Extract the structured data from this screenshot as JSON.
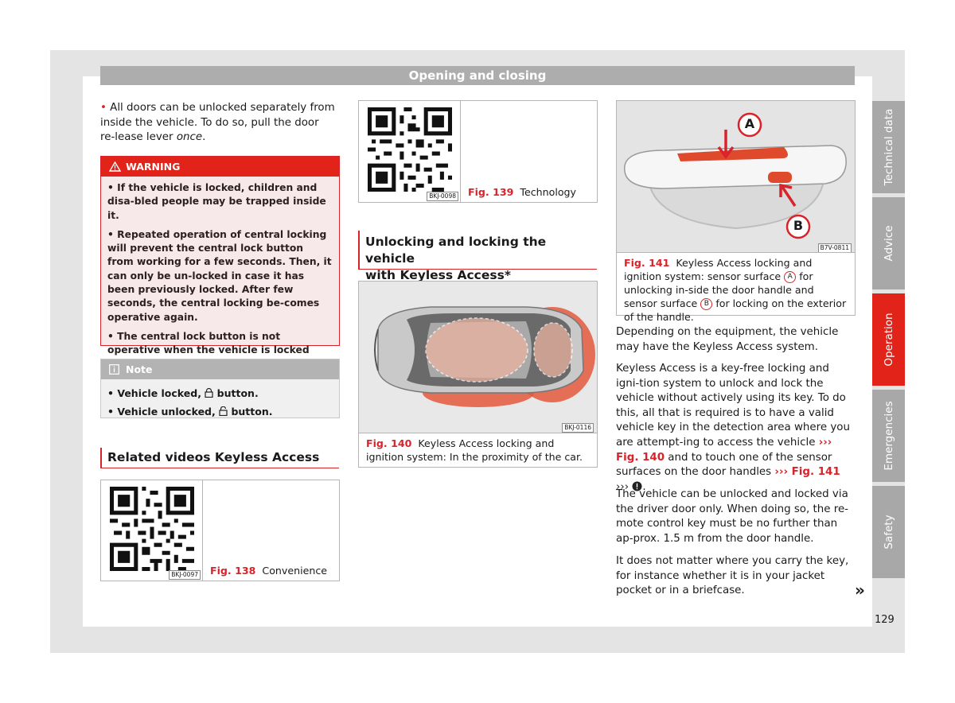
{
  "header": {
    "title": "Opening and closing"
  },
  "col1": {
    "intro_bullet": "•",
    "intro_text_main": " All doors can be unlocked separately from inside the vehicle. To do so, pull the door re-lease lever ",
    "intro_text_em": "once",
    "intro_text_end": ".",
    "warning": {
      "title": "WARNING",
      "items": [
        "• If the vehicle is locked, children and disa-bled people may be trapped inside it.",
        "• Repeated operation of central locking will prevent the central lock button from working for a few seconds. Then, it can only be un-locked in case it has been previously locked. After few seconds, the central locking be-comes operative again.",
        "• The central lock button is not operative when the vehicle is locked from the outside (with the remote control or the key)."
      ]
    },
    "note": {
      "title": "Note",
      "items": [
        {
          "prefix": "• Vehicle locked,",
          "suffix": " button."
        },
        {
          "prefix": "• Vehicle unlocked,",
          "suffix": " button."
        }
      ]
    },
    "related_title": "Related videos Keyless Access",
    "fig138": {
      "code": "BKJ-0097",
      "label": "Fig. 138",
      "caption": "Convenience"
    }
  },
  "col2": {
    "fig139": {
      "code": "BKJ-0098",
      "label": "Fig. 139",
      "caption": "Technology"
    },
    "section_title_line1": "Unlocking and locking the vehicle",
    "section_title_line2": "with Keyless Access*",
    "fig140": {
      "code": "BKJ-0116",
      "label": "Fig. 140",
      "caption": "Keyless Access locking and ignition system: In the proximity of the car."
    }
  },
  "col3": {
    "fig141": {
      "code": "B7V-0811",
      "marker_a": "A",
      "marker_b": "B",
      "label": "Fig. 141",
      "caption_1": "Keyless Access locking and ignition system: sensor surface",
      "caption_2": "for unlocking in-side the door handle and sensor surface",
      "caption_3": "for locking on the exterior of the handle."
    },
    "para1": "Depending on the equipment, the vehicle may have the Keyless Access system.",
    "para2_a": "Keyless Access is a key-free locking and igni-tion system to unlock and lock the vehicle without actively using its key. To do this, all that is required is to have a valid vehicle key in the detection area where you are attempt-ing to access the vehicle ",
    "para2_ref1": "››› Fig. 140",
    "para2_b": " and to touch one of the sensor surfaces on the door handles ",
    "para2_ref2": "››› Fig. 141",
    "para2_c": " ››› ",
    "para2_d": ".",
    "para3": "The vehicle can be unlocked and locked via the driver door only. When doing so, the re-mote control key must be no further than ap-prox. 1.5 m from the door handle.",
    "para4": "It does not matter where you carry the key, for instance whether it is in your jacket pocket or in a briefcase.",
    "continue_mark": "»"
  },
  "tabs": [
    "Technical data",
    "Advice",
    "Operation",
    "Emergencies",
    "Safety"
  ],
  "active_tab": "Operation",
  "page_number": "129",
  "colors": {
    "accent": "#e2231a",
    "tab_inactive": "#a8a8a8",
    "header": "#adadad"
  }
}
